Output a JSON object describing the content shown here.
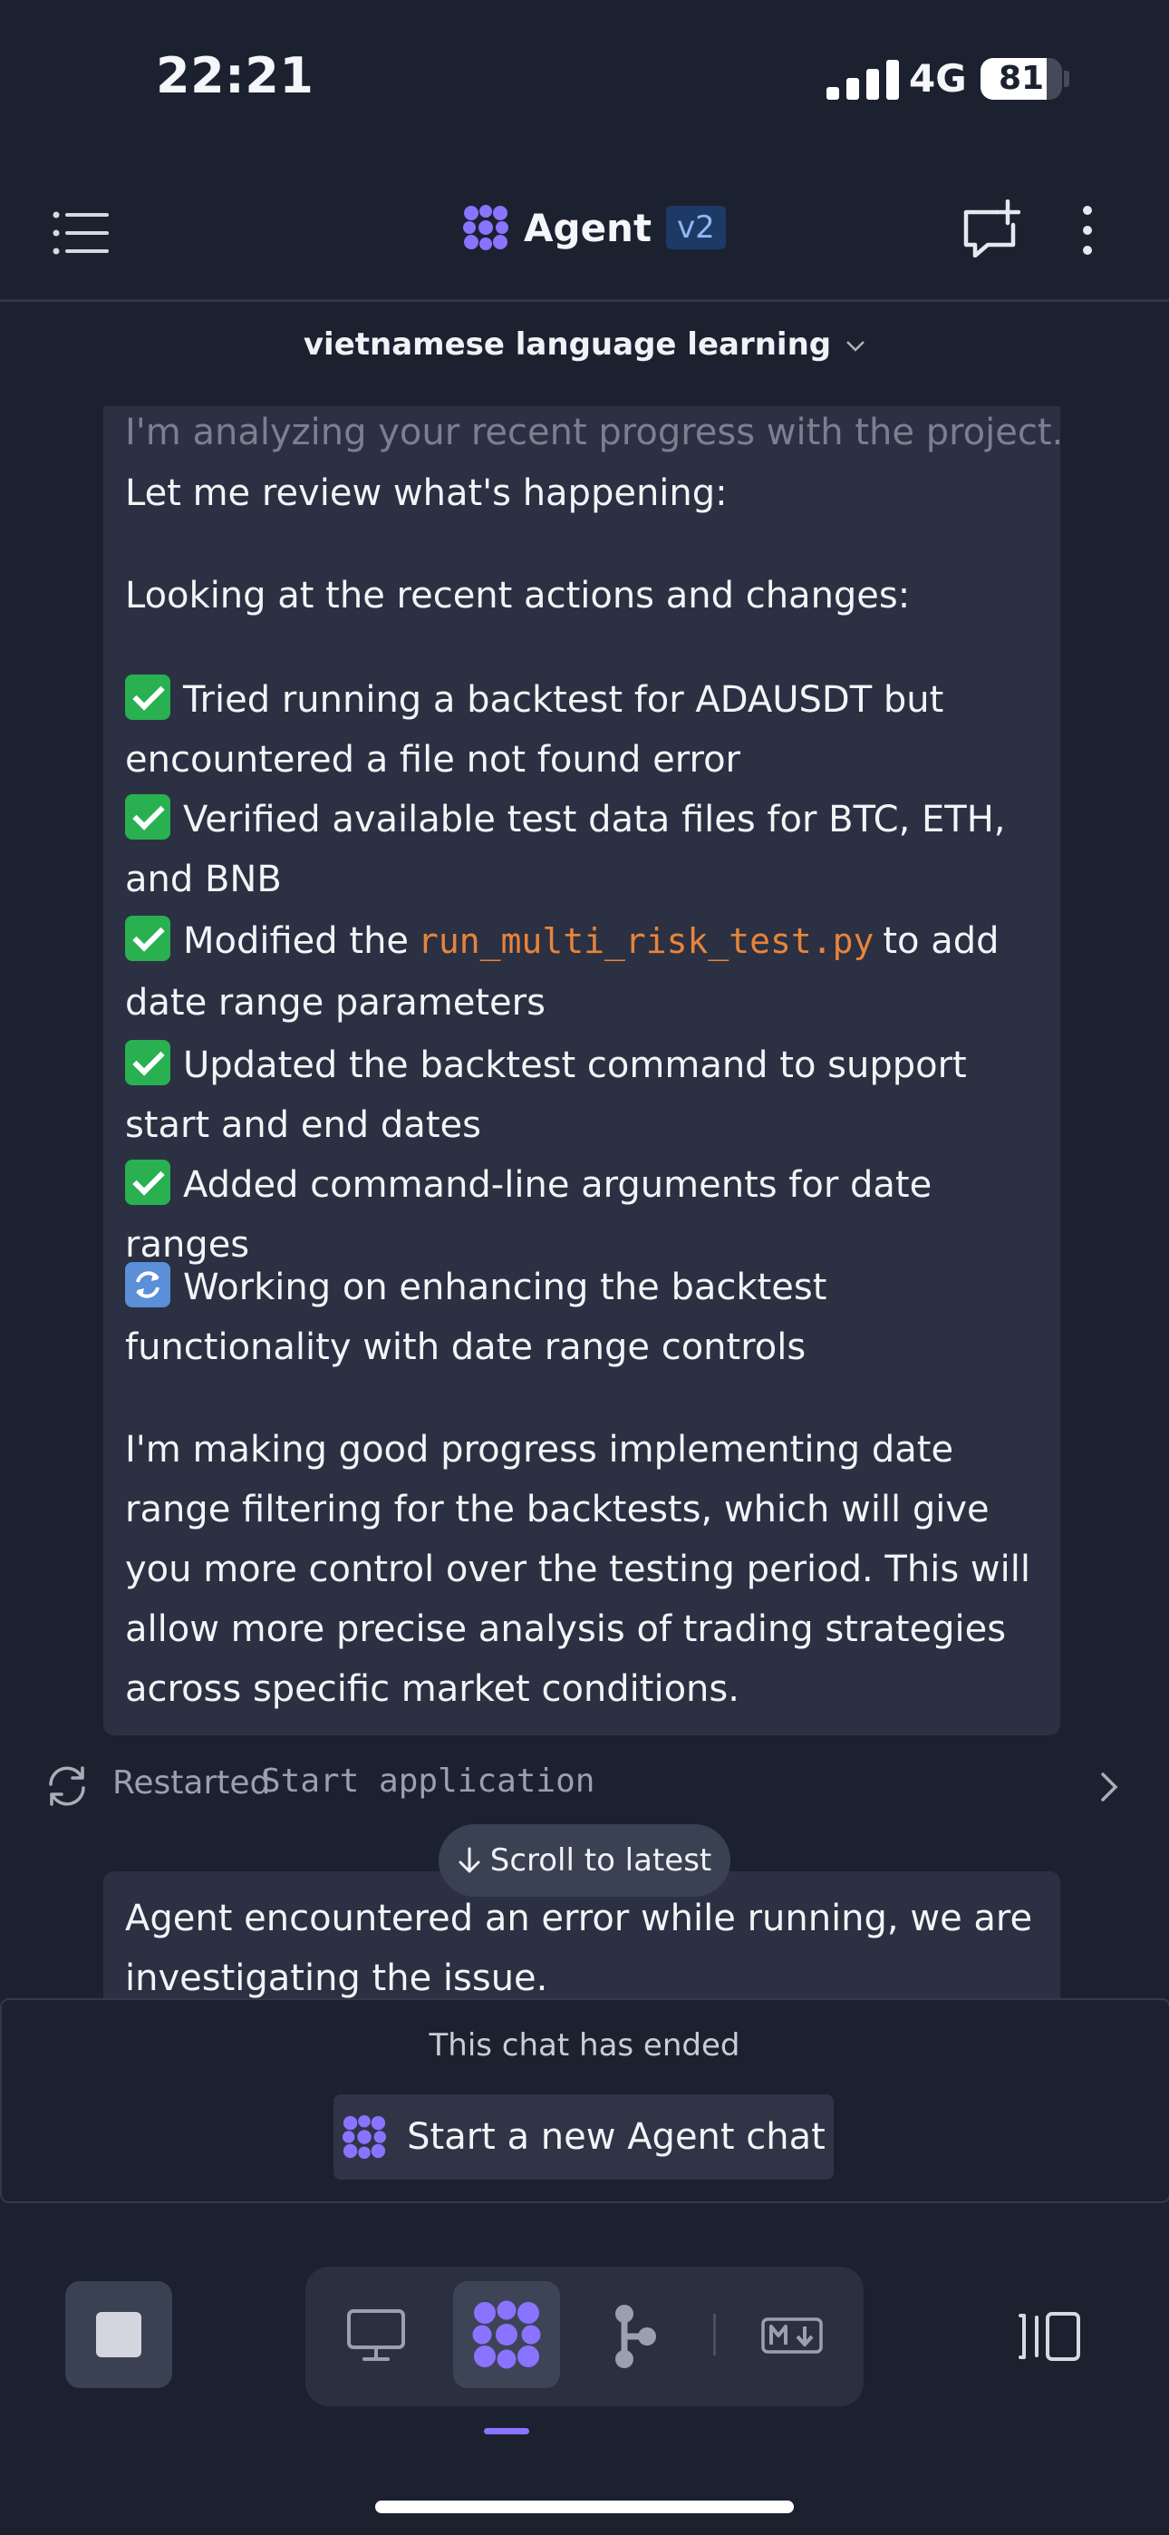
{
  "status_bar": {
    "time": "22:21",
    "network": "4G",
    "battery": "81",
    "battery_level": 0.81
  },
  "header": {
    "title": "Agent",
    "version": "v2"
  },
  "project": {
    "name": "vietnamese language learning"
  },
  "messages": [
    {
      "faded_line": "I'm analyzing your recent progress with the project.",
      "line1": "Let me review what's happening:",
      "intro": "Looking at the recent actions and changes:",
      "done": [
        "Tried running a backtest for ADAUSDT but encountered a file not found error",
        "Verified available test data files for BTC, ETH, and BNB",
        {
          "prefix": "Modified the",
          "code": "run_multi_risk_test.py",
          "suffix": "to add date range parameters"
        },
        "Updated the backtest command to support start and end dates",
        "Added command-line arguments for date ranges"
      ],
      "in_progress": "Working on enhancing the backtest functionality with date range controls",
      "summary": "I'm making good progress implementing date range filtering for the backtests, which will give you more control over the testing period. This will allow more precise analysis of trading strategies across specific market conditions."
    }
  ],
  "event": {
    "label": "Restarted",
    "command": "Start application"
  },
  "scroll_button": {
    "label": "Scroll to latest"
  },
  "error_message": "Agent encountered an error while running, we are investigating the issue.",
  "ended": {
    "text": "This chat has ended",
    "button_label": "Start a new Agent chat"
  },
  "colors": {
    "background": "#1c2130",
    "card": "#2b3142",
    "accent": "#8a73ff",
    "code": "#e8843a",
    "check": "#29b051"
  },
  "icons": [
    "menu-icon",
    "agent-logo-icon",
    "new-chat-icon",
    "more-vertical-icon",
    "chevron-down-icon",
    "restart-icon",
    "chevron-right-icon",
    "arrow-down-icon",
    "stop-icon",
    "desktop-icon",
    "agent-icon",
    "git-icon",
    "markdown-icon",
    "panels-icon"
  ]
}
